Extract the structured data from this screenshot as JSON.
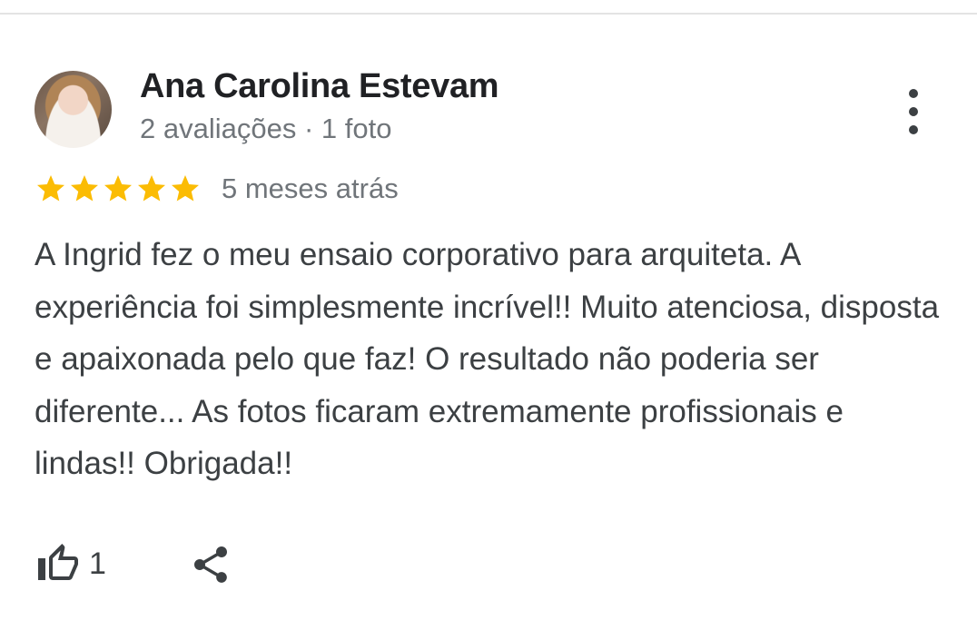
{
  "review": {
    "reviewer_name": "Ana Carolina Estevam",
    "reviewer_meta": "2 avaliações · 1 foto",
    "rating": 5,
    "rating_max": 5,
    "time_ago": "5 meses atrás",
    "text": "A Ingrid fez o meu ensaio corporativo para arquiteta. A experiência foi simplesmente incrível!! Muito atenciosa, disposta e apaixonada pelo que faz! O resultado não poderia ser diferente... As fotos ficaram extremamente profissionais e lindas!! Obrigada!!",
    "like_count": "1"
  },
  "icons": {
    "more": "more-vert-icon",
    "star": "star-icon",
    "like": "thumb-up-icon",
    "share": "share-icon"
  },
  "colors": {
    "star": "#fbbc04",
    "name": "#202124",
    "meta": "#70757a",
    "body_text": "#3c4043"
  }
}
